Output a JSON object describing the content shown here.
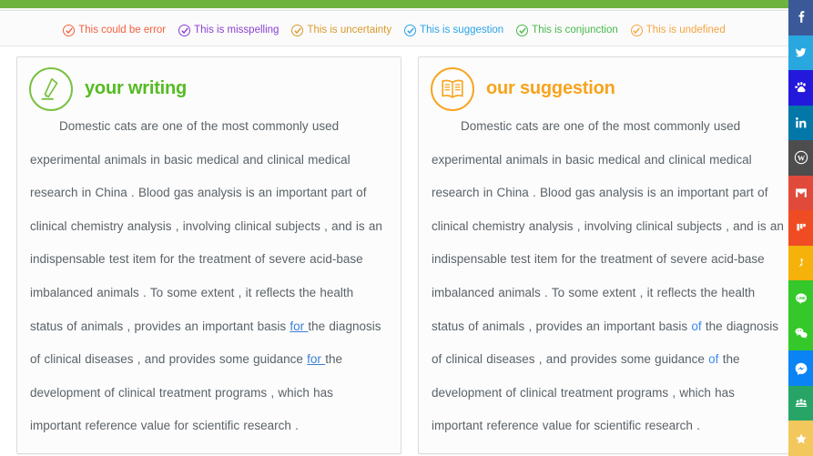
{
  "topbar": {
    "color": "#6db33f"
  },
  "legend": {
    "items": [
      {
        "label": "This could be error",
        "color": "#f4603e",
        "icon": "check-circle-icon"
      },
      {
        "label": "This is misspelling",
        "color": "#8a3fd1",
        "icon": "check-circle-icon"
      },
      {
        "label": "This is uncertainty",
        "color": "#d99a2b",
        "icon": "check-circle-icon"
      },
      {
        "label": "This is suggestion",
        "color": "#2aa3e8",
        "icon": "check-circle-icon"
      },
      {
        "label": "This is conjunction",
        "color": "#46b84a",
        "icon": "check-circle-icon"
      },
      {
        "label": "This is undefined",
        "color": "#f7a440",
        "icon": "check-circle-icon"
      }
    ]
  },
  "panels": {
    "left": {
      "title": "your writing",
      "icon": "pen-icon",
      "accent": "#55bb22",
      "text_parts": [
        {
          "type": "text",
          "value": "Domestic cats are one of the most commonly used experimental animals in basic medical and clinical medical research in China . Blood gas analysis is an important part of clinical chemistry analysis , involving clinical subjects , and is an indispensable test item for the treatment of severe acid-base imbalanced animals . To some extent , it reflects the health status of animals , provides an important basis "
        },
        {
          "type": "suggestion-underline",
          "value": "for "
        },
        {
          "type": "text",
          "value": "the diagnosis of clinical diseases , and provides some guidance "
        },
        {
          "type": "suggestion-underline",
          "value": "for "
        },
        {
          "type": "text",
          "value": "the development of clinical treatment programs , which has important reference value for scientific research ."
        }
      ]
    },
    "right": {
      "title": "our suggestion",
      "icon": "book-icon",
      "accent": "#f7a31c",
      "text_parts": [
        {
          "type": "text",
          "value": "Domestic cats are one of the most commonly used experimental animals in basic medical and clinical medical research in China . Blood gas analysis is an important part of clinical chemistry analysis , involving clinical subjects , and is an indispensable test item for the treatment of severe acid-base imbalanced animals . To some extent , it reflects the health status of animals , provides an important basis "
        },
        {
          "type": "suggestion",
          "value": "of"
        },
        {
          "type": "text",
          "value": " the diagnosis of clinical diseases , and provides some guidance "
        },
        {
          "type": "suggestion",
          "value": "of"
        },
        {
          "type": "text",
          "value": " the development of clinical treatment programs , which has important reference value for scientific research ."
        }
      ]
    }
  },
  "social": {
    "items": [
      {
        "name": "facebook",
        "label": "Facebook",
        "color": "#3b5998"
      },
      {
        "name": "twitter",
        "label": "Twitter",
        "color": "#29a8e0"
      },
      {
        "name": "baidu",
        "label": "Baidu",
        "color": "#2319dc"
      },
      {
        "name": "linkedin",
        "label": "LinkedIn",
        "color": "#0277a8"
      },
      {
        "name": "wordpress",
        "label": "WordPress",
        "color": "#4d4d4d"
      },
      {
        "name": "gmail",
        "label": "Gmail",
        "color": "#e14a3b"
      },
      {
        "name": "mix",
        "label": "Mix",
        "color": "#f04c24"
      },
      {
        "name": "pocket",
        "label": "Pocket",
        "color": "#f5b20a"
      },
      {
        "name": "line",
        "label": "LINE",
        "color": "#35c82a"
      },
      {
        "name": "wechat",
        "label": "WeChat",
        "color": "#35c82a"
      },
      {
        "name": "messenger",
        "label": "Messenger",
        "color": "#0a83f5"
      },
      {
        "name": "meetup",
        "label": "Meetup",
        "color": "#27a567"
      },
      {
        "name": "favorite",
        "label": "Favorite",
        "color": "#f2c75c"
      }
    ]
  }
}
